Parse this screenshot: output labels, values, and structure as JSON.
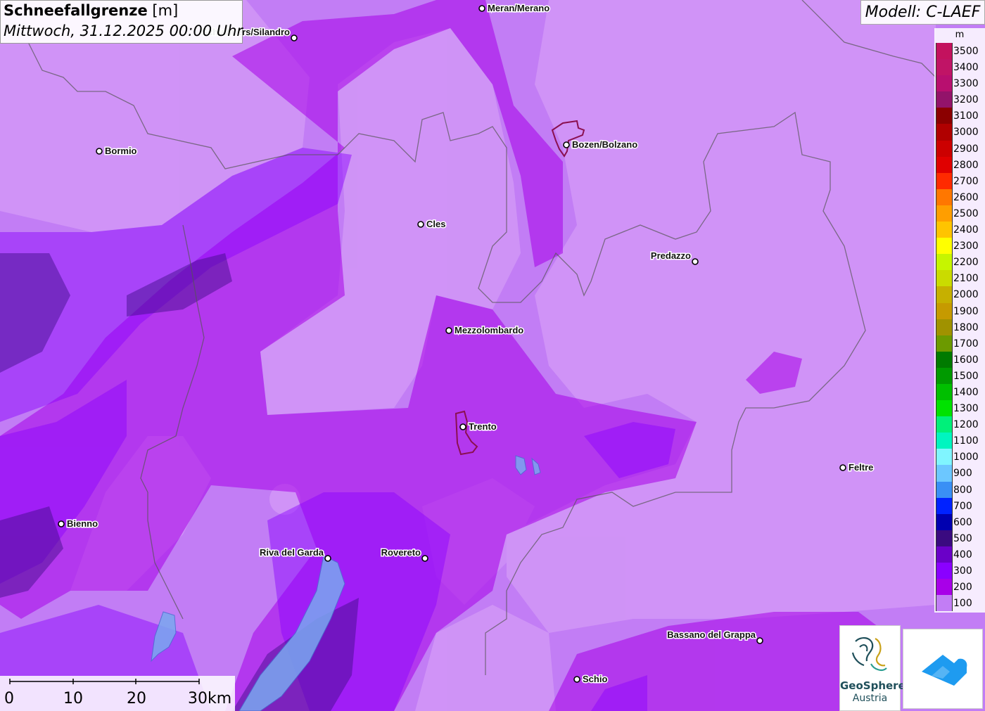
{
  "title": {
    "main": "Schneefallgrenze",
    "unit": "[m]",
    "datetime": "Mittwoch, 31.12.2025 00:00 Uhr"
  },
  "model": "Modell: C-LAEF",
  "legend": {
    "unit": "m",
    "entries": [
      {
        "label": "3500",
        "color": "#c3125e"
      },
      {
        "label": "3400",
        "color": "#c01466"
      },
      {
        "label": "3300",
        "color": "#b80f6f"
      },
      {
        "label": "3200",
        "color": "#93136a"
      },
      {
        "label": "3100",
        "color": "#8b0000"
      },
      {
        "label": "3000",
        "color": "#b00000"
      },
      {
        "label": "2900",
        "color": "#cc0000"
      },
      {
        "label": "2800",
        "color": "#e00000"
      },
      {
        "label": "2700",
        "color": "#ff2a00"
      },
      {
        "label": "2600",
        "color": "#ff7700"
      },
      {
        "label": "2500",
        "color": "#ff9e00"
      },
      {
        "label": "2400",
        "color": "#ffc400"
      },
      {
        "label": "2300",
        "color": "#ffff00"
      },
      {
        "label": "2200",
        "color": "#c6f500"
      },
      {
        "label": "2100",
        "color": "#cadb00"
      },
      {
        "label": "2000",
        "color": "#c6b000"
      },
      {
        "label": "1900",
        "color": "#c69a00"
      },
      {
        "label": "1800",
        "color": "#a09200"
      },
      {
        "label": "1700",
        "color": "#6c9a00"
      },
      {
        "label": "1600",
        "color": "#007a00"
      },
      {
        "label": "1500",
        "color": "#009a00"
      },
      {
        "label": "1400",
        "color": "#00bf00"
      },
      {
        "label": "1300",
        "color": "#00e200"
      },
      {
        "label": "1200",
        "color": "#00f07a"
      },
      {
        "label": "1100",
        "color": "#00f5c0"
      },
      {
        "label": "1000",
        "color": "#80f5ff"
      },
      {
        "label": "900",
        "color": "#6cc7ff"
      },
      {
        "label": "800",
        "color": "#3a8ff5"
      },
      {
        "label": "700",
        "color": "#0022ff"
      },
      {
        "label": "600",
        "color": "#0000b0"
      },
      {
        "label": "500",
        "color": "#3a0a80"
      },
      {
        "label": "400",
        "color": "#6a00c8"
      },
      {
        "label": "300",
        "color": "#8a00ff"
      },
      {
        "label": "200",
        "color": "#a800e8"
      },
      {
        "label": "100",
        "color": "#c27df5"
      }
    ]
  },
  "cities": [
    {
      "name": "Meran/Merano",
      "side": "right"
    },
    {
      "name": "Schlanders/Silandro",
      "side": "left"
    },
    {
      "name": "Bozen/Bolzano",
      "side": "right"
    },
    {
      "name": "Bormio",
      "side": "right"
    },
    {
      "name": "Cles",
      "side": "right"
    },
    {
      "name": "Predazzo",
      "side": "left"
    },
    {
      "name": "Mezzolombardo",
      "side": "right"
    },
    {
      "name": "Trento",
      "side": "right"
    },
    {
      "name": "Feltre",
      "side": "right"
    },
    {
      "name": "Bienno",
      "side": "right"
    },
    {
      "name": "Riva del Garda",
      "side": "left"
    },
    {
      "name": "Rovereto",
      "side": "left"
    },
    {
      "name": "Bassano del Grappa",
      "side": "left"
    },
    {
      "name": "Schio",
      "side": "right"
    }
  ],
  "scale": {
    "labels": [
      "0",
      "10",
      "20",
      "30km"
    ]
  },
  "logos": {
    "geosphere_line1": "GeoSphere",
    "geosphere_line2": "Austria"
  },
  "colors": {
    "base_100m": "#c27df5",
    "lighter_fill": "#d49bf7",
    "band_200m": "#a800e8",
    "band_300m": "#8a00ff",
    "band_400m": "#6a00c8",
    "band_500m": "#3a0a80",
    "logo_blue": "#1e9bf0"
  }
}
